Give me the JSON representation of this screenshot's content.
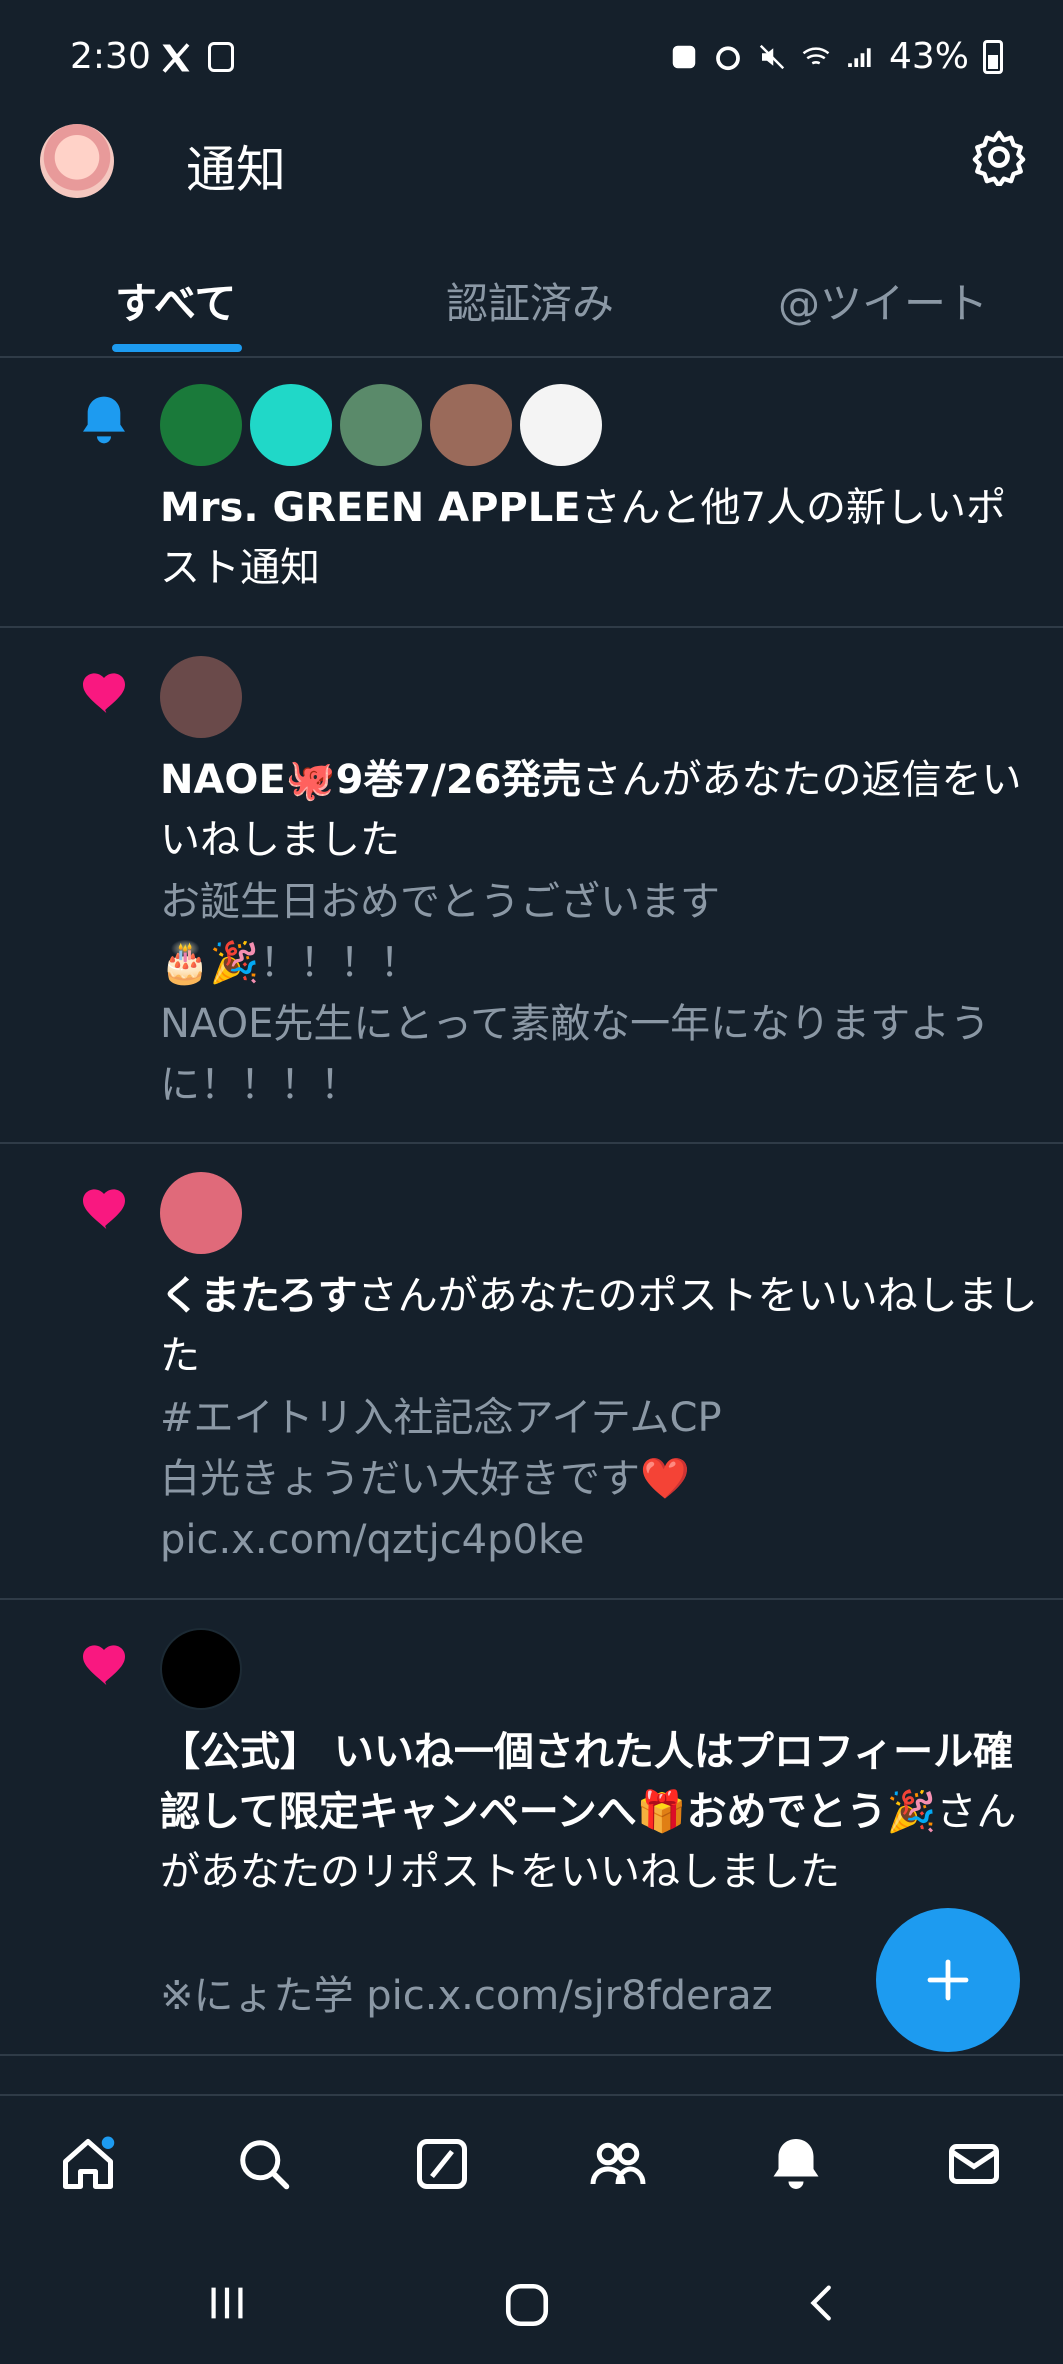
{
  "status_bar": {
    "time": "2:30",
    "battery": "43%"
  },
  "header": {
    "title": "通知"
  },
  "tabs": [
    {
      "label": "すべて",
      "active": true
    },
    {
      "label": "認証済み",
      "active": false
    },
    {
      "label": "@ツイート",
      "active": false
    }
  ],
  "notifications": [
    {
      "type": "new-post",
      "icon": "bell-icon",
      "bold": "Mrs. GREEN APPLE",
      "text": "さんと他7人の新しいポスト通知",
      "sub": ""
    },
    {
      "type": "like",
      "icon": "heart-icon",
      "bold": "NAOE🐙9巻7/26発売",
      "text": "さんがあなたの返信をいいねしました",
      "sub_lines": [
        "お誕生日おめでとうございます",
        "🎂🎉！！！！",
        "NAOE先生にとって素敵な一年になりますように！！！！"
      ]
    },
    {
      "type": "like",
      "icon": "heart-icon",
      "bold": "くまたろす",
      "text": "さんがあなたのポストをいいねしました",
      "sub_lines": [
        "#エイトリ入社記念アイテムCP",
        "白光きょうだい大好きです❤️ pic.x.com/qztjc4p0ke"
      ]
    },
    {
      "type": "like",
      "icon": "heart-icon",
      "bold": "【公式】 いいね一個された人はプロフィール確認して限定キャンペーンへ🎁おめでとう🎉",
      "text": "さんがあなたのリポストをいいねしました",
      "sub_lines": [
        "※にょた学 pic.x.com/sjr8fderaz"
      ]
    }
  ],
  "colors": {
    "accent": "#1d9bf0",
    "like": "#f91880",
    "background": "#15202b",
    "muted": "#8b98a5"
  },
  "bottom_nav": [
    "home-icon",
    "search-icon",
    "grok-icon",
    "communities-icon",
    "notifications-icon",
    "messages-icon"
  ]
}
